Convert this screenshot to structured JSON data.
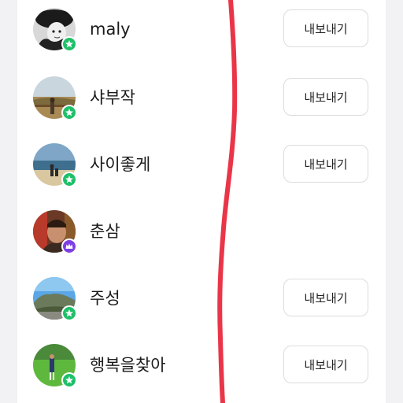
{
  "members": [
    {
      "nickname": "maly",
      "badge": "green-star-badge-icon",
      "export_label": "내보내기",
      "has_export": true
    },
    {
      "nickname": "샤부작",
      "badge": "green-star-badge-icon",
      "export_label": "내보내기",
      "has_export": true
    },
    {
      "nickname": "사이좋게",
      "badge": "green-star-badge-icon",
      "export_label": "내보내기",
      "has_export": true
    },
    {
      "nickname": "춘삼",
      "badge": "purple-crown-badge-icon",
      "export_label": "",
      "has_export": false
    },
    {
      "nickname": "주성",
      "badge": "green-star-badge-icon",
      "export_label": "내보내기",
      "has_export": true
    },
    {
      "nickname": "행복을찾아",
      "badge": "green-star-badge-icon",
      "export_label": "내보내기",
      "has_export": true
    }
  ],
  "colors": {
    "background": "#f2f2f4",
    "card": "#ffffff",
    "member_badge": "#1fbf6a",
    "host_badge": "#7b3fe4",
    "button_border": "#dcdcdf",
    "handwritten_mark": "#e8243a"
  }
}
